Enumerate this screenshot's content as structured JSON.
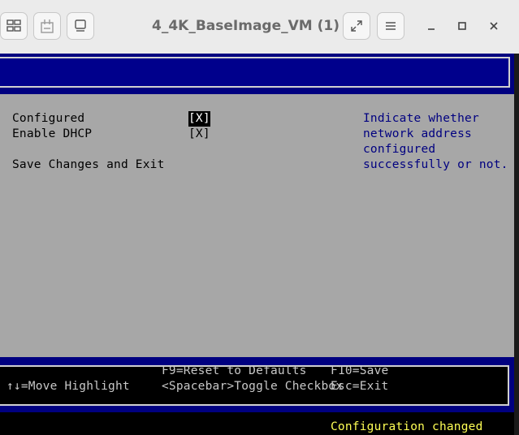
{
  "window": {
    "title": "4_4K_BaseImage_VM (1)"
  },
  "toolbar": {
    "buttons": [
      {
        "icon": "layout-icon"
      },
      {
        "icon": "usb-device-icon"
      },
      {
        "icon": "display-icon"
      }
    ],
    "right_buttons": [
      {
        "icon": "fullscreen-icon"
      },
      {
        "icon": "menu-icon"
      }
    ]
  },
  "form": {
    "items": [
      {
        "label": "Configured",
        "checkbox": "[X]",
        "selected": true
      },
      {
        "label": "Enable DHCP",
        "checkbox": "[X]",
        "selected": false
      }
    ],
    "action": "Save Changes and Exit",
    "help": [
      "Indicate whether",
      "network address",
      "configured",
      "successfully or not."
    ]
  },
  "footer": {
    "hints": {
      "move": "↑↓=Move Highlight",
      "reset": "F9=Reset to Defaults",
      "toggle": "<Spacebar>Toggle Checkbox",
      "save": "F10=Save",
      "exit": "Esc=Exit"
    },
    "status": "Configuration changed"
  },
  "colors": {
    "bios_blue": "#000080",
    "bios_gray": "#a7a7a7",
    "status_yellow": "#ffff55"
  }
}
